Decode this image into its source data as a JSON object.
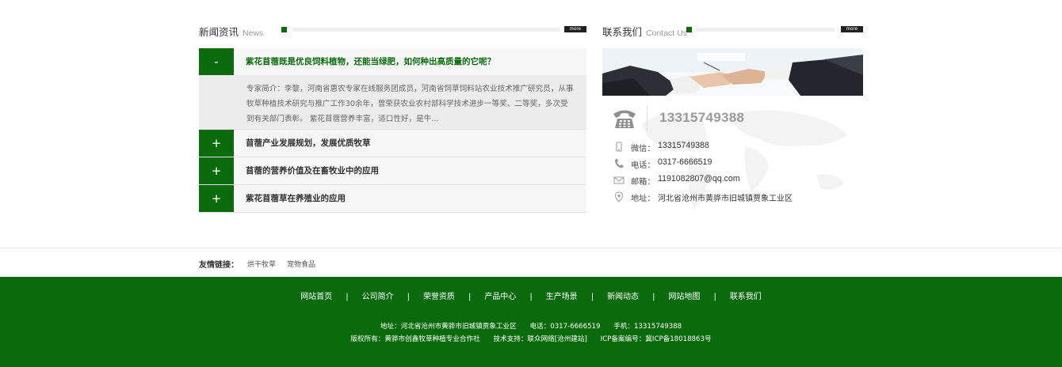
{
  "news": {
    "title": "新闻资讯",
    "title_en": "News",
    "more": "more",
    "items": [
      {
        "toggle": "-",
        "question": "紫花苜蓿既是优良饲料植物，还能当绿肥，如何种出高质量的它呢？",
        "body": "专家简介：李黎，河南省惠农专家在线服务团成员，河南省饲草饲料站农业技术推广研究员，从事牧草种植技术研究与推广工作30余年，曾荣获农业农村部科学技术进步一等奖、二等奖，多次受到有关部门表彰。  紫花苜蓿营养丰富，适口性好，是牛..."
      },
      {
        "toggle": "+",
        "question": "苜蓿产业发展规划，发展优质牧草"
      },
      {
        "toggle": "+",
        "question": "苜蓿的营养价值及在畜牧业中的应用"
      },
      {
        "toggle": "+",
        "question": "紫花苜蓿草在养殖业的应用"
      }
    ]
  },
  "contact": {
    "title": "联系我们",
    "title_en": "Contact Us",
    "more": "more",
    "big_phone": "13315749388",
    "rows": [
      {
        "icon": "mobile-icon",
        "label": "微信：",
        "value": "13315749388"
      },
      {
        "icon": "phone-icon",
        "label": "电话：",
        "value": "0317-6666519"
      },
      {
        "icon": "mail-icon",
        "label": "邮箱：",
        "value": "1191082807@qq.com"
      },
      {
        "icon": "location-icon",
        "label": "地址：",
        "value": "河北省沧州市黄骅市旧城镇贾象工业区"
      }
    ]
  },
  "friend_links": {
    "title": "友情链接：",
    "links": [
      "烘干牧草",
      "宠物食品"
    ]
  },
  "footer": {
    "nav": [
      "网站首页",
      "公司简介",
      "荣誉资质",
      "产品中心",
      "生产场景",
      "新闻动态",
      "网站地图",
      "联系我们"
    ],
    "separator": "|",
    "address": "地址：河北省沧州市黄骅市旧城镇贾象工业区",
    "phone": "电话：0317-6666519",
    "mobile": "手机：13315749388",
    "copyright": "版权所有：黄骅市创鑫牧草种植专业合作社",
    "support": "技术支持：联众网络[沧州建站]",
    "icp": "ICP备案编号：冀ICP备18018863号"
  },
  "colors": {
    "brand_green": "#0a6b0d",
    "title_gray": "#999999"
  }
}
